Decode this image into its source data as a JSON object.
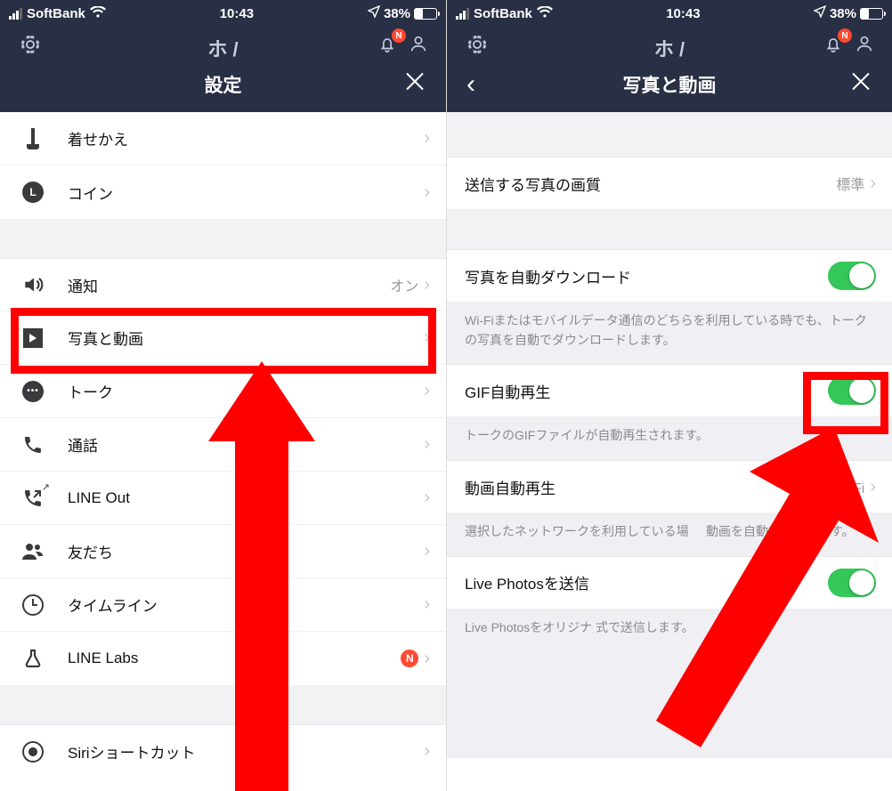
{
  "status": {
    "carrier": "SoftBank",
    "time": "10:43",
    "battery_pct": "38%"
  },
  "left": {
    "title": "設定",
    "badge_letter": "N",
    "rows": {
      "theme": "着せかえ",
      "coin": "コイン",
      "coin_letter": "L",
      "notif": "通知",
      "notif_value": "オン",
      "photo_video": "写真と動画",
      "talk": "トーク",
      "call": "通話",
      "line_out": "LINE Out",
      "friends": "友だち",
      "timeline": "タイムライン",
      "labs": "LINE Labs",
      "labs_badge": "N",
      "siri": "Siriショートカット"
    }
  },
  "right": {
    "title": "写真と動画",
    "badge_letter": "N",
    "rows": {
      "photo_quality": "送信する写真の画質",
      "photo_quality_value": "標準",
      "auto_dl": "写真を自動ダウンロード",
      "auto_dl_desc": "Wi-Fiまたはモバイルデータ通信のどちらを利用している時でも、トークの写真を自動でダウンロードします。",
      "gif": "GIF自動再生",
      "gif_desc": "トークのGIFファイルが自動再生されます。",
      "video": "動画自動再生",
      "video_value_partial": "とWi-Fi",
      "video_desc_partial_a": "選択したネットワークを利用している場",
      "video_desc_partial_b": "動画を自動で再生します。",
      "live": "Live Photosを送信",
      "live_desc_partial": "Live Photosをオリジナ          式で送信します。"
    }
  }
}
